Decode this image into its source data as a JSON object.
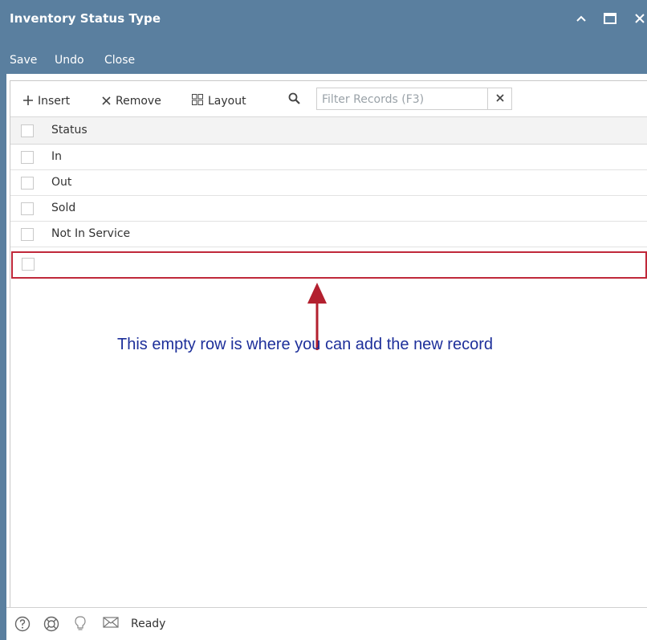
{
  "window": {
    "title": "Inventory Status Type",
    "controls": {
      "minimize_icon": "chevron-up-icon",
      "maximize_icon": "square-icon",
      "close_icon": "close-icon"
    }
  },
  "menu": {
    "save": "Save",
    "undo": "Undo",
    "close": "Close"
  },
  "toolbar": {
    "insert": "Insert",
    "remove": "Remove",
    "layout": "Layout",
    "filter_placeholder": "Filter Records (F3)",
    "filter_value": ""
  },
  "grid": {
    "header": "Status",
    "rows": [
      "In",
      "Out",
      "Sold",
      "Not In Service"
    ]
  },
  "annotation": {
    "text": "This empty row is where you can add the new record"
  },
  "statusbar": {
    "status": "Ready"
  },
  "colors": {
    "titlebar": "#5a7f9f",
    "highlight": "#c0283a",
    "annotation_text": "#1d2f9a"
  }
}
